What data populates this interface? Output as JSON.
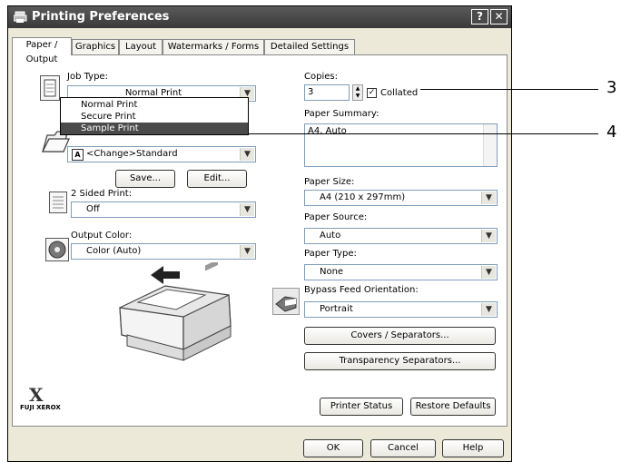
{
  "window": {
    "title": "Printing Preferences",
    "help_btn": "?",
    "close_btn": "✕"
  },
  "tabs": [
    {
      "label": "Paper / Output"
    },
    {
      "label": "Graphics"
    },
    {
      "label": "Layout"
    },
    {
      "label": "Watermarks / Forms"
    },
    {
      "label": "Detailed Settings"
    }
  ],
  "job_type": {
    "label": "Job Type:",
    "value": "Normal Print",
    "options": [
      "Normal Print",
      "Secure Print",
      "Sample Print"
    ],
    "selected_option": "Sample Print"
  },
  "paper_set": {
    "value": "<Change>Standard",
    "badge": "A"
  },
  "save_button": "Save...",
  "edit_button": "Edit...",
  "two_sided": {
    "label": "2 Sided Print:",
    "value": "Off"
  },
  "output_color": {
    "label": "Output Color:",
    "value": "Color (Auto)"
  },
  "copies": {
    "label": "Copies:",
    "value": "3",
    "collated_label": "Collated",
    "collated_checked": true
  },
  "paper_summary": {
    "label": "Paper Summary:",
    "value": "A4, Auto"
  },
  "paper_size": {
    "label": "Paper Size:",
    "value": "A4 (210 x 297mm)"
  },
  "paper_source": {
    "label": "Paper Source:",
    "value": "Auto"
  },
  "paper_type": {
    "label": "Paper Type:",
    "value": "None"
  },
  "bypass_orientation": {
    "label": "Bypass Feed Orientation:",
    "value": "Portrait"
  },
  "covers_button": "Covers / Separators...",
  "transparency_button": "Transparency Separators...",
  "printer_status_button": "Printer Status",
  "restore_defaults_button": "Restore Defaults",
  "brand": {
    "logo": "X",
    "name": "FUJI XEROX"
  },
  "footer": {
    "ok": "OK",
    "cancel": "Cancel",
    "help": "Help"
  },
  "callouts": [
    "3",
    "4"
  ]
}
